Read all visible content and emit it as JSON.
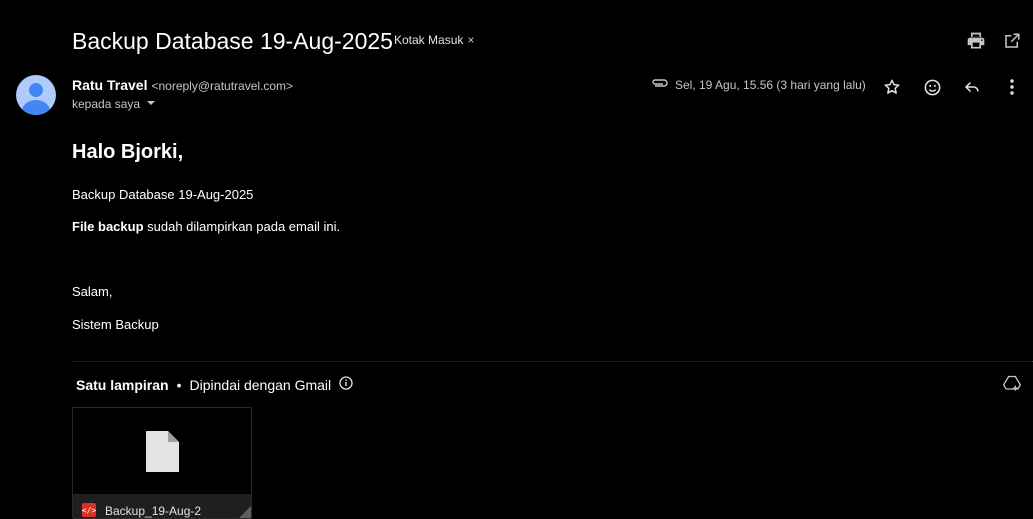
{
  "header": {
    "subject": "Backup Database 19-Aug-2025",
    "label": "Kotak Masuk",
    "label_remove": "×"
  },
  "toolbar_top": {
    "print_icon": "print-icon",
    "open_new_window_icon": "open-in-new-icon"
  },
  "sender": {
    "name": "Ratu Travel",
    "email": "<noreply@ratutravel.com>",
    "to": "kepada saya"
  },
  "meta": {
    "date": "Sel, 19 Agu, 15.56 (3 hari yang lalu)"
  },
  "body": {
    "greeting": "Halo Bjorki,",
    "line1": "Backup Database 19-Aug-2025",
    "line2_bold": "File backup",
    "line2_rest": " sudah dilampirkan pada email ini.",
    "closing1": "Salam,",
    "closing2": "Sistem Backup"
  },
  "attachments": {
    "title": "Satu lampiran",
    "separator": "•",
    "scanned": "Dipindai dengan Gmail",
    "file_name": "Backup_19-Aug-2"
  },
  "colors": {
    "background": "#000000",
    "text": "#e3e3e3",
    "avatar": "#aecbfa",
    "avatar_figure": "#4285f4",
    "file_badge": "#d93025"
  }
}
